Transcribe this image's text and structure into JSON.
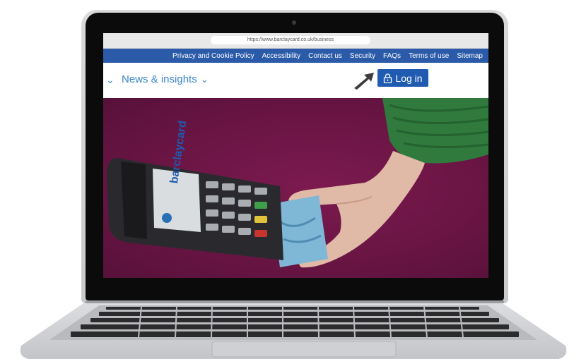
{
  "browser": {
    "url": "https://www.barclaycard.co.uk/business"
  },
  "top_nav": {
    "items": [
      "Privacy and Cookie Policy",
      "Accessibility",
      "Contact us",
      "Security",
      "FAQs",
      "Terms of use",
      "Sitemap"
    ]
  },
  "main_nav": {
    "news_label": "News & insights",
    "login_label": "Log in"
  },
  "hero": {
    "terminal_brand": "barclaycard"
  },
  "colors": {
    "nav_blue": "#2a5aa8",
    "link_blue": "#3b86c9",
    "button_blue": "#1f5bb0",
    "hero_magenta": "#6a1544",
    "sleeve_green": "#2f7a3c"
  },
  "icons": [
    "chevron-down-icon",
    "lock-icon",
    "arrow-pointer-icon"
  ]
}
